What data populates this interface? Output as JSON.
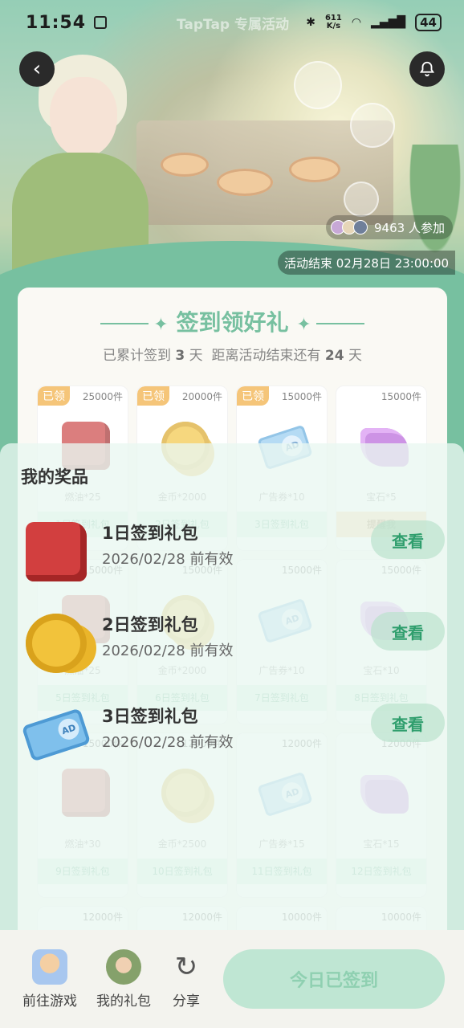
{
  "status_bar": {
    "time": "11:54",
    "center_text": "TapTap 专属活动",
    "net_speed_value": "611",
    "net_speed_unit": "K/s",
    "battery": "44"
  },
  "hero": {
    "participants": "9463 人参加",
    "end_time": "活动结束 02月28日 23:00:00"
  },
  "checkin": {
    "title": "签到领好礼",
    "summary_prefix": "已累计签到",
    "days_count": "3",
    "summary_mid": "天  距离活动结束还有",
    "days_left": "24",
    "summary_suffix": "天",
    "tiles": [
      {
        "got": "已领",
        "stock": "25000件",
        "name": "燃油*25",
        "pkg": "1日签到礼包",
        "art": "fuel"
      },
      {
        "got": "已领",
        "stock": "20000件",
        "name": "金币*2000",
        "pkg": "2日签到礼包",
        "art": "coin"
      },
      {
        "got": "已领",
        "stock": "15000件",
        "name": "广告券*10",
        "pkg": "3日签到礼包",
        "art": "ticket"
      },
      {
        "got": "",
        "stock": "15000件",
        "name": "宝石*5",
        "pkg": "提醒我",
        "art": "gem"
      },
      {
        "got": "",
        "stock": "15000件",
        "name": "燃油*25",
        "pkg": "5日签到礼包",
        "art": "fuel"
      },
      {
        "got": "",
        "stock": "15000件",
        "name": "金币*2000",
        "pkg": "6日签到礼包",
        "art": "coin"
      },
      {
        "got": "",
        "stock": "15000件",
        "name": "广告券*10",
        "pkg": "7日签到礼包",
        "art": "ticket"
      },
      {
        "got": "",
        "stock": "15000件",
        "name": "宝石*10",
        "pkg": "8日签到礼包",
        "art": "gem"
      },
      {
        "got": "",
        "stock": "15000件",
        "name": "燃油*30",
        "pkg": "9日签到礼包",
        "art": "fuel"
      },
      {
        "got": "",
        "stock": "12000件",
        "name": "金币*2500",
        "pkg": "10日签到礼包",
        "art": "coin"
      },
      {
        "got": "",
        "stock": "12000件",
        "name": "广告券*15",
        "pkg": "11日签到礼包",
        "art": "ticket"
      },
      {
        "got": "",
        "stock": "12000件",
        "name": "宝石*15",
        "pkg": "12日签到礼包",
        "art": "gem"
      },
      {
        "got": "",
        "stock": "12000件",
        "name": "",
        "pkg": "",
        "art": ""
      },
      {
        "got": "",
        "stock": "12000件",
        "name": "",
        "pkg": "",
        "art": ""
      },
      {
        "got": "",
        "stock": "10000件",
        "name": "",
        "pkg": "",
        "art": ""
      },
      {
        "got": "",
        "stock": "10000件",
        "name": "",
        "pkg": "",
        "art": ""
      }
    ]
  },
  "prizes": {
    "title": "我的奖品",
    "items": [
      {
        "name": "1日签到礼包",
        "valid": "2026/02/28 前有效",
        "action": "查看",
        "icon": "fuel-can-icon"
      },
      {
        "name": "2日签到礼包",
        "valid": "2026/02/28 前有效",
        "action": "查看",
        "icon": "gold-coins-icon"
      },
      {
        "name": "3日签到礼包",
        "valid": "2026/02/28 前有效",
        "action": "查看",
        "icon": "ad-ticket-icon"
      }
    ]
  },
  "bottom_bar": {
    "go_game": "前往游戏",
    "my_gifts": "我的礼包",
    "share": "分享",
    "checkin_button": "今日已签到"
  }
}
